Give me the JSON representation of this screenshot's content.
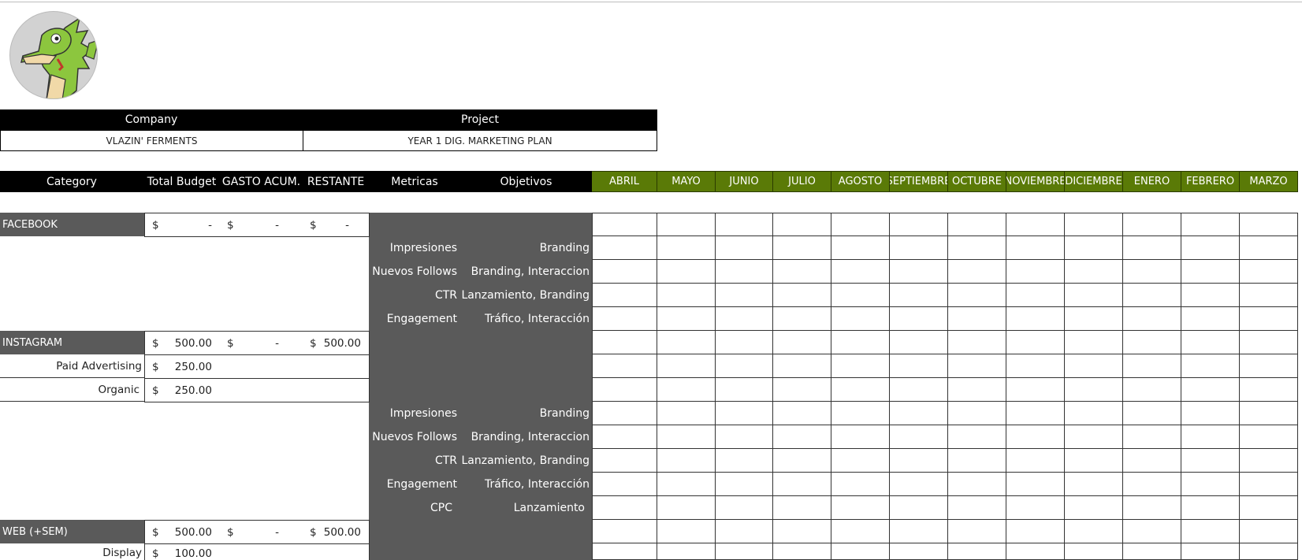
{
  "logo": {
    "icon": "dragon-mascot-icon"
  },
  "info": {
    "company_label": "Company",
    "project_label": "Project",
    "company_value": "VLAZIN' FERMENTS",
    "project_value": "YEAR 1 DIG. MARKETING PLAN"
  },
  "header": {
    "category": "Category",
    "total_budget": "Total Budget",
    "gasto": "GASTO ACUM.",
    "restante": "RESTANTE",
    "metricas": "Metricas",
    "objetivos": "Objetivos",
    "months": [
      "ABRIL",
      "MAYO",
      "JUNIO",
      "JULIO",
      "AGOSTO",
      "SEPTIEMBRE",
      "OCTUBRE",
      "NOVIEMBRE",
      "DICIEMBRE",
      "ENERO",
      "FEBRERO",
      "MARZO"
    ]
  },
  "colors": {
    "month_header": "#5a7a07",
    "category_fill": "#5a5a5a",
    "black": "#000000"
  },
  "rows": {
    "facebook": {
      "name": "FACEBOOK",
      "cur1": "$",
      "total": "-",
      "cur2": "$",
      "gasto": "-",
      "cur3": "$",
      "restante": "-"
    },
    "instagram": {
      "name": "INSTAGRAM",
      "cur1": "$",
      "total": "500.00",
      "cur2": "$",
      "gasto": "-",
      "cur3": "$",
      "restante": "500.00"
    },
    "paid": {
      "name": "Paid Advertising",
      "cur": "$",
      "total": "250.00"
    },
    "organic": {
      "name": "Organic",
      "cur": "$",
      "total": "250.00"
    },
    "web": {
      "name": "WEB (+SEM)",
      "cur1": "$",
      "total": "500.00",
      "cur2": "$",
      "gasto": "-",
      "cur3": "$",
      "restante": "500.00"
    },
    "display": {
      "name": "Display",
      "cur": "$",
      "total": "100.00"
    }
  },
  "metrics_block_1": [
    {
      "metrica": "Impresiones",
      "objetivo": "Branding"
    },
    {
      "metrica": "Nuevos Follows",
      "objetivo": "Branding, Interaccion"
    },
    {
      "metrica": "CTR",
      "objetivo": "Lanzamiento, Branding"
    },
    {
      "metrica": "Engagement",
      "objetivo": "Tráfico, Interacción"
    }
  ],
  "metrics_block_2": [
    {
      "metrica": "Impresiones",
      "objetivo": "Branding"
    },
    {
      "metrica": "Nuevos Follows",
      "objetivo": "Branding, Interaccion"
    },
    {
      "metrica": "CTR",
      "objetivo": "Lanzamiento, Branding"
    },
    {
      "metrica": "Engagement",
      "objetivo": "Tráfico, Interacción"
    },
    {
      "metrica": "CPC",
      "objetivo": "Lanzamiento"
    }
  ]
}
